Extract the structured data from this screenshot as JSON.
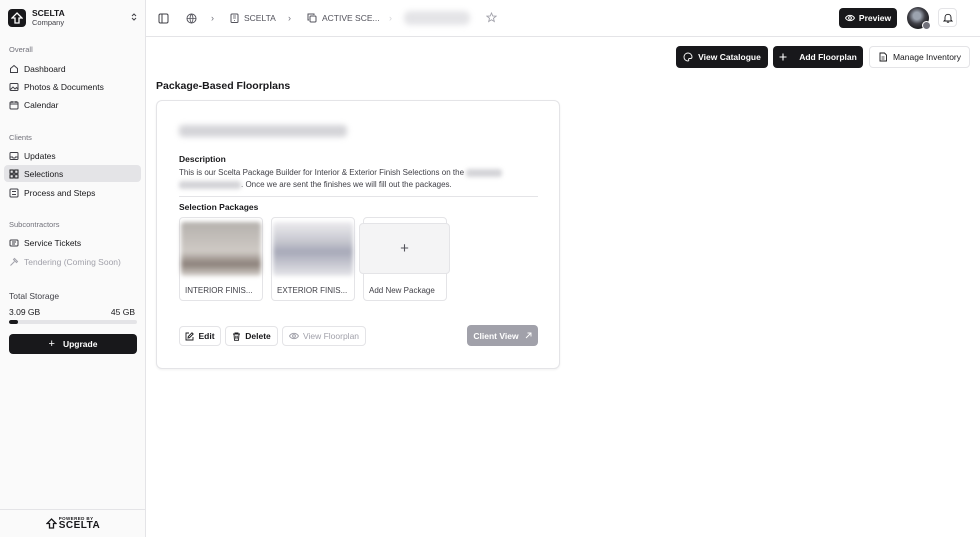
{
  "brand": {
    "name": "SCELTA",
    "subtitle": "Company"
  },
  "sidebar": {
    "sections": [
      {
        "label": "Overall"
      },
      {
        "label": "Clients"
      },
      {
        "label": "Subcontractors"
      }
    ],
    "items": [
      {
        "label": "Dashboard",
        "icon": "home-icon"
      },
      {
        "label": "Photos & Documents",
        "icon": "image-icon"
      },
      {
        "label": "Calendar",
        "icon": "calendar-icon"
      },
      {
        "label": "Updates",
        "icon": "inbox-icon"
      },
      {
        "label": "Selections",
        "icon": "layers-icon",
        "active": true
      },
      {
        "label": "Process and Steps",
        "icon": "list-icon"
      },
      {
        "label": "Service Tickets",
        "icon": "ticket-icon"
      },
      {
        "label": "Tendering (Coming Soon)",
        "icon": "hammer-icon",
        "disabled": true
      }
    ],
    "storage": {
      "label": "Total Storage",
      "used": "3.09 GB",
      "total": "45 GB",
      "fraction": 0.069
    },
    "upgrade_label": "Upgrade",
    "footer": {
      "powered_by": "POWERED BY",
      "brand": "SCELTA"
    }
  },
  "header": {
    "breadcrumbs": [
      {
        "label": "SCELTA"
      },
      {
        "label": "ACTIVE SCE..."
      }
    ],
    "preview_label": "Preview"
  },
  "toolbar": {
    "view_catalogue": "View Catalogue",
    "add_floorplan": "Add Floorplan",
    "manage_inventory": "Manage Inventory"
  },
  "main": {
    "title": "Package-Based Floorplans",
    "card": {
      "description_label": "Description",
      "description_part1": "This is our Scelta Package Builder for Interior & Exterior Finish Selections on the",
      "description_part2": ". Once we are sent the finishes we will fill out the packages.",
      "packages_label": "Selection Packages",
      "packages": [
        {
          "name": "INTERIOR FINIS..."
        },
        {
          "name": "EXTERIOR FINIS..."
        }
      ],
      "add_package_label": "Add New Package",
      "actions": {
        "edit": "Edit",
        "delete": "Delete",
        "view_floorplan": "View Floorplan",
        "client_view": "Client View"
      }
    }
  }
}
